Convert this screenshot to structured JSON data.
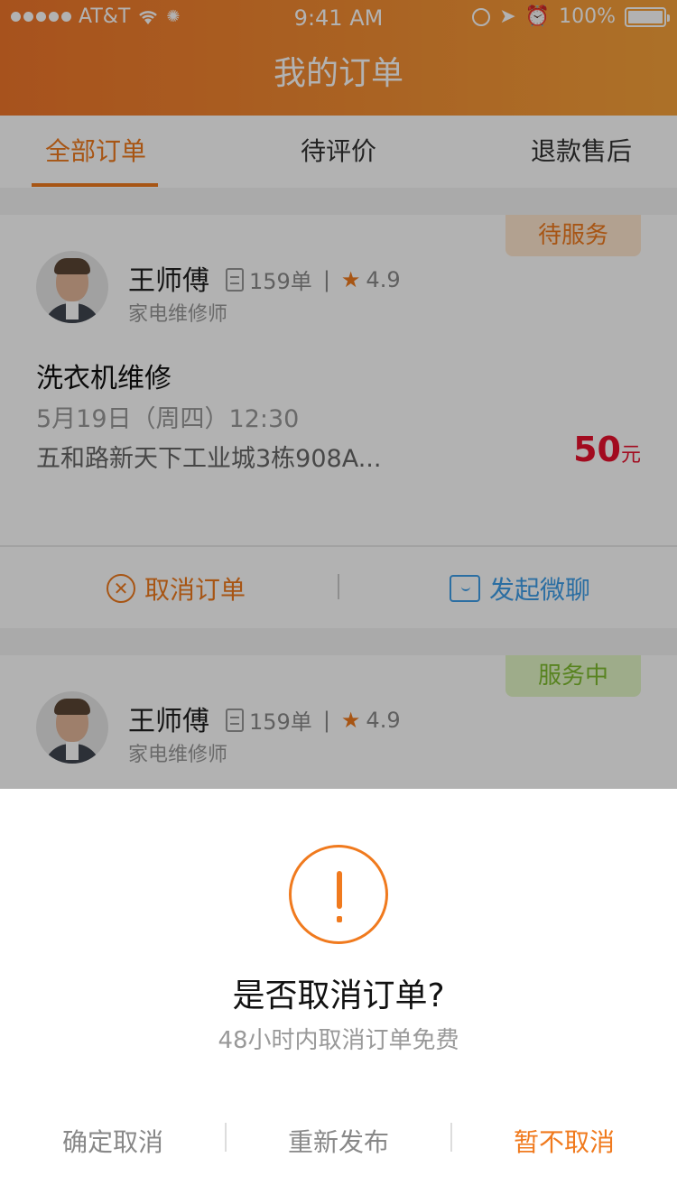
{
  "status_bar": {
    "carrier": "AT&T",
    "time": "9:41 AM",
    "battery": "100%",
    "icons": [
      "signal-dots-icon",
      "wifi-icon",
      "activity-icon",
      "lock-rotation-icon",
      "location-icon",
      "alarm-icon",
      "battery-icon"
    ]
  },
  "header": {
    "title": "我的订单"
  },
  "tabs": [
    {
      "label": "全部订单",
      "active": true
    },
    {
      "label": "待评价",
      "active": false
    },
    {
      "label": "退款售后",
      "active": false
    }
  ],
  "orders": [
    {
      "status": "待服务",
      "name": "王师傅",
      "order_count": "159单",
      "rating": "4.9",
      "role": "家电维修师",
      "service": "洗衣机维修",
      "time": "5月19日（周四）12:30",
      "address": "五和路新天下工业城3栋908A...",
      "price": "50",
      "price_unit": "元",
      "action_cancel": "取消订单",
      "action_chat": "发起微聊"
    },
    {
      "status": "服务中",
      "name": "王师傅",
      "order_count": "159单",
      "rating": "4.9",
      "role": "家电维修师"
    }
  ],
  "dialog": {
    "title": "是否取消订单?",
    "subtitle": "48小时内取消订单免费",
    "buttons": [
      "确定取消",
      "重新发布",
      "暂不取消"
    ]
  },
  "colors": {
    "accent": "#f07a1e",
    "price": "#e8112d",
    "chat": "#3e9ee8",
    "green_badge": "#7fbc2f"
  }
}
